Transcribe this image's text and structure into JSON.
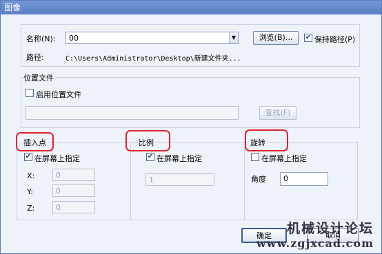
{
  "window": {
    "title": "图像"
  },
  "name_row": {
    "label": "名称(N):",
    "value": "00",
    "browse_label": "浏览(B)...",
    "keep_path_label": "保持路径(P)",
    "keep_path_checked": true
  },
  "path_row": {
    "label": "路径:",
    "value": "C:\\Users\\Administrator\\Desktop\\新建文件夹..."
  },
  "location_file": {
    "title": "位置文件",
    "enable_label": "启用位置文件",
    "enable_checked": false,
    "path_value": "",
    "find_label": "查找(F)"
  },
  "insertion_point": {
    "title": "插入点",
    "on_screen_label": "在屏幕上指定",
    "on_screen_checked": true,
    "x_label": "X:",
    "x_value": "0",
    "y_label": "Y:",
    "y_value": "0",
    "z_label": "Z:",
    "z_value": "0"
  },
  "scale": {
    "title": "比例",
    "on_screen_label": "在屏幕上指定",
    "on_screen_checked": true,
    "value": "1"
  },
  "rotation": {
    "title": "旋转",
    "on_screen_label": "在屏幕上指定",
    "on_screen_checked": false,
    "angle_label": "角度",
    "angle_value": "0"
  },
  "buttons": {
    "ok": "确定",
    "cancel": "取消"
  },
  "watermark": {
    "title": "机械设计论坛",
    "url": "www.zgjxcad.com"
  },
  "colors": {
    "highlight": "#e0212d",
    "titlebar": "#5a80c4"
  }
}
